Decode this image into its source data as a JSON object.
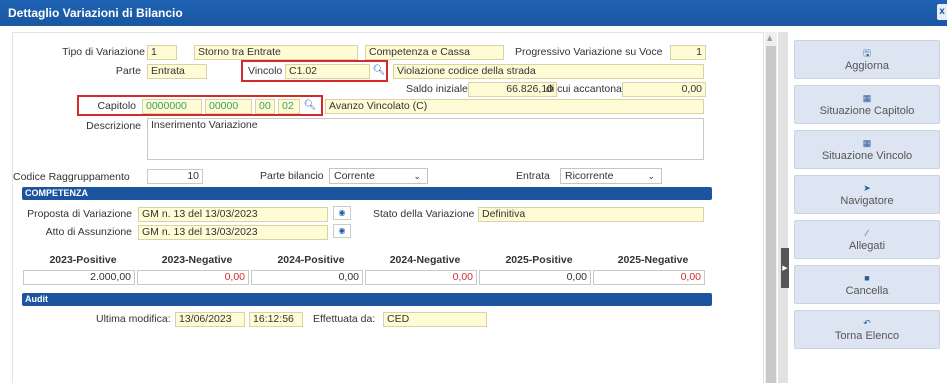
{
  "window": {
    "title": "Dettaglio Variazioni di Bilancio",
    "close_label": "x"
  },
  "form": {
    "tipo_label": "Tipo di Variazione",
    "tipo_code": "1",
    "tipo_desc": "Storno tra Entrate",
    "tipo_mode": "Competenza e Cassa",
    "progressivo_label": "Progressivo Variazione su Voce",
    "progressivo_value": "1",
    "parte_label": "Parte",
    "parte_value": "Entrata",
    "vincolo_label": "Vincolo",
    "vincolo_code": "C1.02",
    "vincolo_desc": "Violazione codice della strada",
    "saldo_label": "Saldo iniziale",
    "saldo_value": "66.826,10",
    "accantonato_label": "di cui accantonato",
    "accantonato_value": "0,00",
    "capitolo_label": "Capitolo",
    "capitolo_1": "0000000",
    "capitolo_2": "00000",
    "capitolo_3": "00",
    "capitolo_4": "02",
    "capitolo_desc": "Avanzo Vincolato (C)",
    "descrizione_label": "Descrizione",
    "descrizione_value": "Inserimento Variazione",
    "raggruppamento_label": "Codice Raggruppamento",
    "raggruppamento_value": "10",
    "parte_bilancio_label": "Parte bilancio",
    "parte_bilancio_value": "Corrente",
    "entrata_label": "Entrata",
    "entrata_value": "Ricorrente"
  },
  "competenza": {
    "header": "COMPETENZA",
    "proposta_label": "Proposta di Variazione",
    "proposta_value": "GM n. 13 del 13/03/2023",
    "stato_label": "Stato della Variazione",
    "stato_value": "Definitiva",
    "atto_label": "Atto di Assunzione",
    "atto_value": "GM n. 13 del 13/03/2023",
    "columns": [
      "2023-Positive",
      "2023-Negative",
      "2024-Positive",
      "2024-Negative",
      "2025-Positive",
      "2025-Negative"
    ],
    "values": [
      "2.000,00",
      "0,00",
      "0,00",
      "0,00",
      "0,00",
      "0,00"
    ]
  },
  "audit": {
    "header": "Audit",
    "ultima_label": "Ultima modifica:",
    "ultima_date": "13/06/2023",
    "ultima_time": "16:12:56",
    "effettuata_label": "Effettuata da:",
    "effettuata_value": "CED"
  },
  "sidebar": {
    "buttons": [
      {
        "label": "Aggiorna",
        "icon": "save-icon"
      },
      {
        "label": "Situazione Capitolo",
        "icon": "calculator-icon"
      },
      {
        "label": "Situazione Vincolo",
        "icon": "grid-icon"
      },
      {
        "label": "Navigatore",
        "icon": "navigate-icon"
      },
      {
        "label": "Allegati",
        "icon": "paperclip-icon"
      },
      {
        "label": "Cancella",
        "icon": "trash-icon"
      },
      {
        "label": "Torna Elenco",
        "icon": "undo-icon"
      }
    ]
  },
  "colors": {
    "header_blue": "#1c54a0",
    "field_yellow": "#fefbd5",
    "highlight_red": "#d42a2a",
    "negative_red": "#d03030",
    "code_green": "#3aa06a"
  }
}
